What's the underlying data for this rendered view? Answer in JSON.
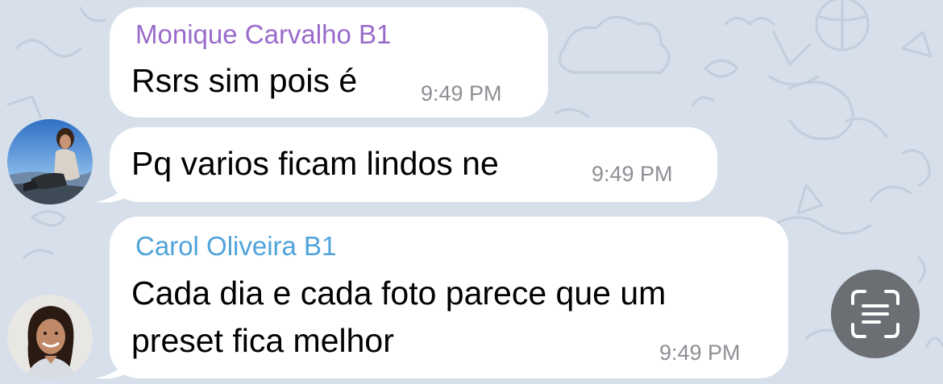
{
  "chat": {
    "messages": [
      {
        "sender": "Monique Carvalho B1",
        "sender_color": "#9a6bcb",
        "lines": [
          "Rsrs sim pois é"
        ],
        "time": "9:49 PM"
      },
      {
        "sender": "",
        "lines": [
          "Pq varios ficam lindos ne"
        ],
        "time": "9:49 PM"
      },
      {
        "sender": "Carol Oliveira B1",
        "sender_color": "#4fa3da",
        "lines": [
          "Cada dia e cada foto parece que um",
          "preset fica melhor"
        ],
        "time": "9:49 PM"
      }
    ]
  },
  "colors": {
    "chat_background": "#d6dfea",
    "bubble": "#ffffff",
    "timestamp": "#8c8f94",
    "live_text_button": "#6b6e72"
  },
  "icons": {
    "live_text": "live-text-scan-icon"
  }
}
